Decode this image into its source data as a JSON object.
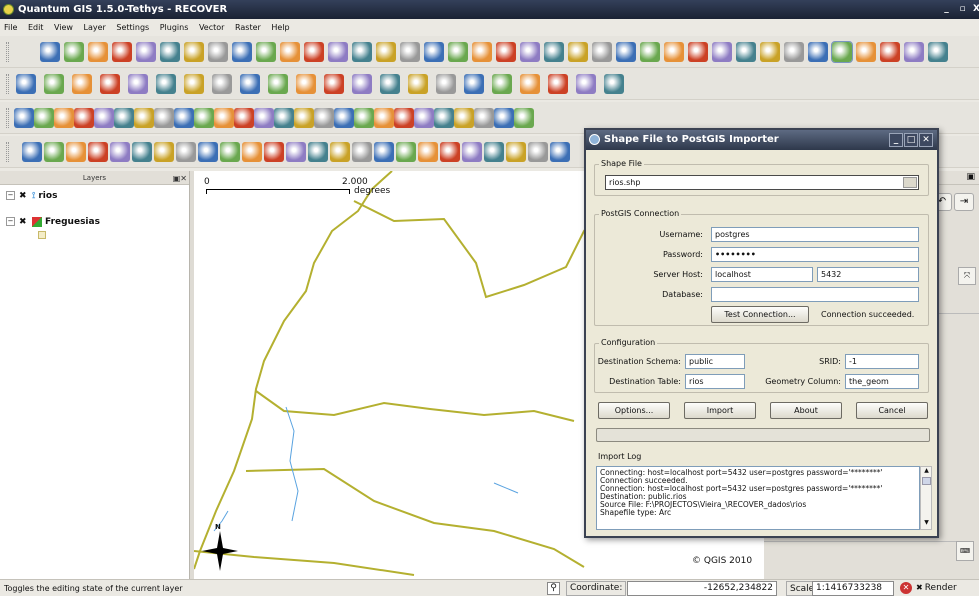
{
  "window": {
    "title": "Quantum GIS 1.5.0-Tethys - RECOVER",
    "min": "_",
    "restore": "▫",
    "close": "X"
  },
  "menu": [
    "File",
    "Edit",
    "View",
    "Layer",
    "Settings",
    "Plugins",
    "Vector",
    "Raster",
    "Help"
  ],
  "layers_panel": {
    "title": "Layers",
    "layers": [
      {
        "name": "rios",
        "checked": "✖"
      },
      {
        "name": "Freguesias",
        "checked": "✖"
      }
    ]
  },
  "map": {
    "scale_zero": "0",
    "scale_value": "2.000",
    "scale_unit": "degrees",
    "copyright": "© QGIS 2010",
    "north_label": "N",
    "colors": {
      "boundary": "#b4b030",
      "river": "#5aa3e0"
    }
  },
  "status": {
    "message": "Toggles the editing state of the current layer",
    "coordinate_label": "Coordinate:",
    "coordinate_value": "-12652,234822",
    "scale_label": "Scale",
    "scale_value": "1:1416733238",
    "render_label": "Render"
  },
  "dialog": {
    "title": "Shape File to PostGIS Importer",
    "shapefile_group": "Shape File",
    "shapefile_value": "rios.shp",
    "connection_group": "PostGIS Connection",
    "username_label": "Username:",
    "username": "postgres",
    "password_label": "Password:",
    "password": "••••••••",
    "host_label": "Server Host:",
    "host": "localhost",
    "port": "5432",
    "database_label": "Database:",
    "database": "",
    "test_button": "Test Connection...",
    "test_status": "Connection succeeded.",
    "config_group": "Configuration",
    "schema_label": "Destination Schema:",
    "schema": "public",
    "srid_label": "SRID:",
    "srid": "-1",
    "table_label": "Destination Table:",
    "table": "rios",
    "geomcol_label": "Geometry Column:",
    "geomcol": "the_geom",
    "buttons": {
      "options": "Options...",
      "import": "Import",
      "about": "About",
      "cancel": "Cancel"
    },
    "log_group": "Import Log",
    "log": [
      "Connecting: host=localhost port=5432 user=postgres password='********'",
      "Connection succeeded.",
      "Connection: host=localhost port=5432 user=postgres password='********'",
      "Destination: public.rios",
      "Source File: F:\\PROJECTOS\\Vieira_\\RECOVER_dados\\rios",
      "Shapefile type: Arc"
    ]
  }
}
